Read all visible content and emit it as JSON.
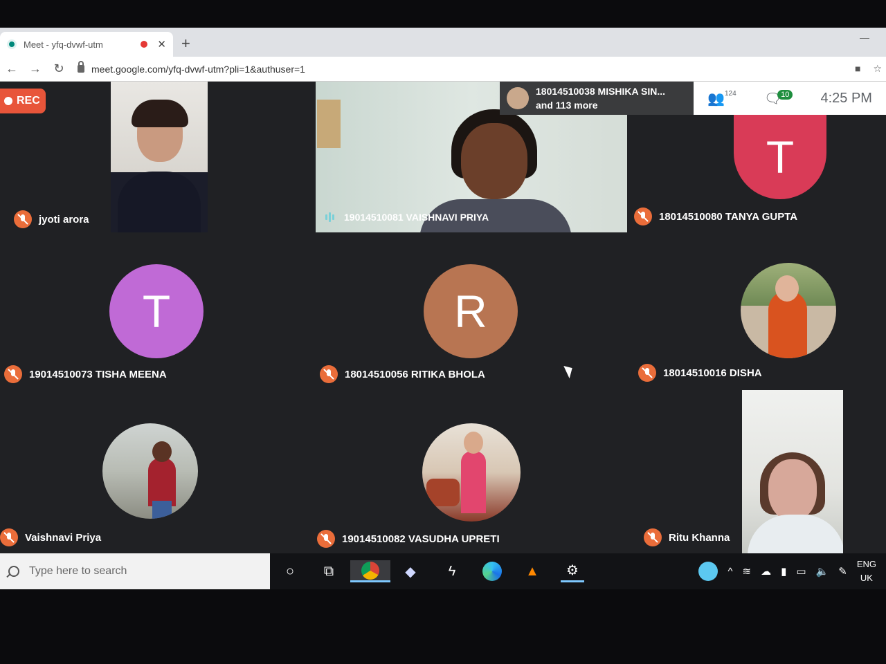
{
  "browser": {
    "tab_title": "Meet - yfq-dvwf-utm",
    "tab_close": "✕",
    "new_tab": "+",
    "url": "meet.google.com/yfq-dvwf-utm?pli=1&authuser=1",
    "nav_back": "←",
    "nav_forward": "→",
    "nav_reload": "↻"
  },
  "meet": {
    "rec_label": "REC",
    "presenter_name": "18014510038 MISHIKA SIN...",
    "presenter_more": "and 113 more",
    "participant_count": "124",
    "chat_count": "10",
    "time": "4:25 PM",
    "participants": [
      {
        "name": "jyoti arora"
      },
      {
        "name": "19014510081 VAISHNAVI PRIYA"
      },
      {
        "name": "18014510080 TANYA GUPTA",
        "initial": "T",
        "color": "#d93b57"
      },
      {
        "name": "19014510073 TISHA MEENA",
        "initial": "T",
        "color": "#c06ad6"
      },
      {
        "name": "18014510056 RITIKA BHOLA",
        "initial": "R",
        "color": "#b87552"
      },
      {
        "name": "18014510016 DISHA"
      },
      {
        "name": "Vaishnavi Priya"
      },
      {
        "name": "19014510082 VASUDHA UPRETI"
      },
      {
        "name": "Ritu Khanna"
      }
    ]
  },
  "taskbar": {
    "search_placeholder": "Type here to search",
    "lang_top": "ENG",
    "lang_bottom": "UK"
  }
}
